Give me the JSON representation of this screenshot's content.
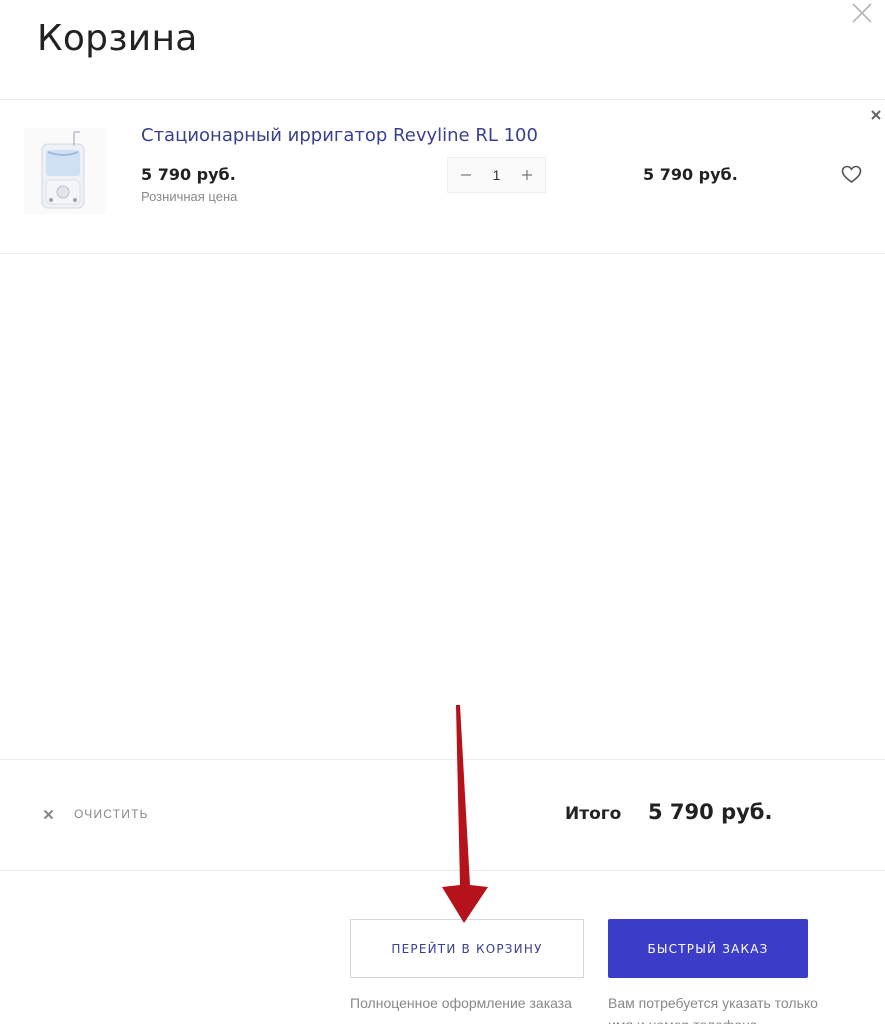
{
  "header": {
    "title": "Корзина"
  },
  "cart": {
    "items": [
      {
        "name": "Стационарный ирригатор Revyline RL 100",
        "unit_price": "5 790 руб.",
        "price_note": "Розничная цена",
        "quantity": "1",
        "total_price": "5 790 руб."
      }
    ]
  },
  "footer": {
    "clear_label": "ОЧИСТИТЬ",
    "sum_label": "Итого",
    "sum_value": "5 790 руб."
  },
  "actions": {
    "go_to_cart_label": "ПЕРЕЙТИ В КОРЗИНУ",
    "go_to_cart_note": "Полноценное оформление заказа",
    "quick_order_label": "БЫСТРЫЙ ЗАКАЗ",
    "quick_order_note": "Вам потребуется указать только имя и номер телефона"
  },
  "colors": {
    "accent": "#3b3cc8",
    "link": "#3b3f8f",
    "annotation_arrow": "#b5121b"
  },
  "icons": {
    "close": "close-icon",
    "remove": "remove-item-icon",
    "minus": "minus-icon",
    "plus": "plus-icon",
    "favorite": "heart-icon",
    "clear": "clear-icon"
  }
}
